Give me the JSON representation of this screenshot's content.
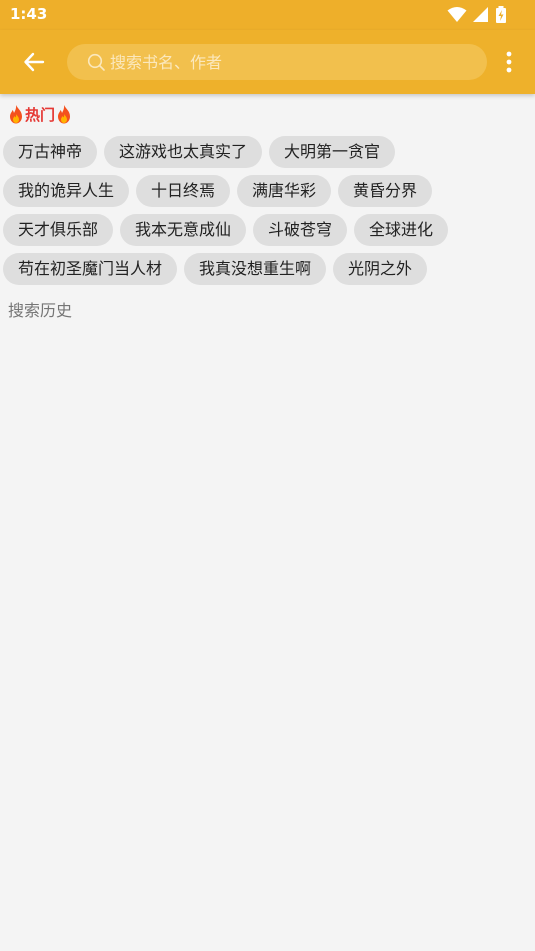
{
  "status_bar": {
    "time": "1:43",
    "icons": [
      "wifi-icon",
      "cell-signal-icon",
      "battery-charging-icon"
    ]
  },
  "app_bar": {
    "back_icon": "arrow-left-icon",
    "search": {
      "placeholder": "搜索书名、作者",
      "value": ""
    },
    "more_icon": "more-vert-icon"
  },
  "hot": {
    "title": "热门",
    "icon": "fire-icon",
    "rows": [
      [
        "万古神帝",
        "这游戏也太真实了",
        "大明第一贪官"
      ],
      [
        "我的诡异人生",
        "十日终焉",
        "满唐华彩",
        "黄昏分界"
      ],
      [
        "天才俱乐部",
        "我本无意成仙",
        "斗破苍穹",
        "全球进化"
      ],
      [
        "苟在初圣魔门当人材",
        "我真没想重生啊",
        "光阴之外"
      ]
    ]
  },
  "history": {
    "title": "搜索历史"
  },
  "colors": {
    "primary": "#eeb12b",
    "search_bg": "#f2c04d",
    "hot_red": "#e53935",
    "tag_bg": "#dedede",
    "page_bg": "#f4f4f4"
  }
}
